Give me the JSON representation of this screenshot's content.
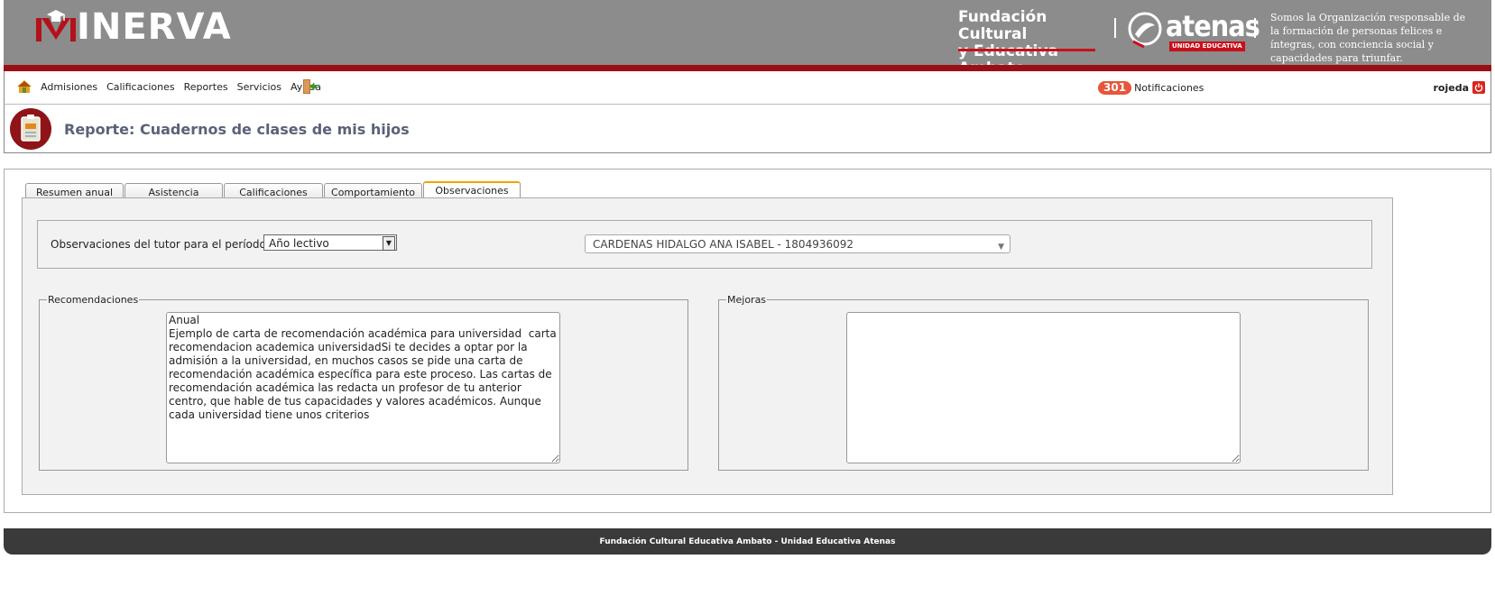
{
  "brand": {
    "name": "INERVA",
    "foundation_line1": "Fundación Cultural",
    "foundation_line2": "y Educativa Ambato",
    "atenas_word": "atenas",
    "atenas_tag": "UNIDAD EDUCATIVA",
    "slogan": "Somos la Organización responsable de la formación de personas felices e íntegras, con conciencia social y capacidades para triunfar.",
    "header_color": "#8c8c8c",
    "accent_red": "#9b0f14"
  },
  "nav": {
    "items": [
      "Admisiones",
      "Calificaciones",
      "Reportes",
      "Servicios",
      "Ayuda"
    ],
    "notif_count": "301",
    "notif_label": "Notificaciones",
    "username": "rojeda"
  },
  "page": {
    "title": "Reporte: Cuadernos de clases de mis hijos"
  },
  "tabs": [
    {
      "label": "Resumen anual",
      "active": false
    },
    {
      "label": "Asistencia",
      "active": false
    },
    {
      "label": "Calificaciones",
      "active": false
    },
    {
      "label": "Comportamiento",
      "active": false
    },
    {
      "label": "Observaciones",
      "active": true
    }
  ],
  "filter": {
    "label": "Observaciones del tutor para el período:",
    "period_value": "Año lectivo",
    "student_value": "CARDENAS HIDALGO ANA ISABEL - 1804936092"
  },
  "recomendaciones": {
    "legend": "Recomendaciones",
    "text": "Anual\nEjemplo de carta de recomendación académica para universidad  carta recomendacion academica universidadSi te decides a optar por la admisión a la universidad, en muchos casos se pide una carta de recomendación académica específica para este proceso. Las cartas de recomendación académica las redacta un profesor de tu anterior centro, que hable de tus capacidades y valores académicos. Aunque cada universidad tiene unos criterios"
  },
  "mejoras": {
    "legend": "Mejoras",
    "text": ""
  },
  "footer": {
    "text": "Fundación Cultural Educativa Ambato - Unidad Educativa Atenas"
  },
  "icons": [
    "mortarboard-m-logo",
    "atenas-logo-icon",
    "home-icon",
    "exit-icon",
    "power-icon",
    "notebook-icon"
  ]
}
